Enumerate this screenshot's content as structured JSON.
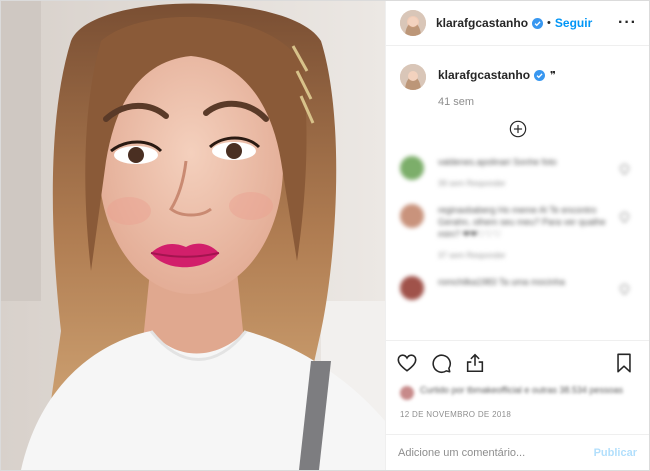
{
  "post": {
    "username": "klarafgcastanho",
    "separator": "•",
    "follow_label": "Seguir",
    "more_label": "···",
    "photo_alt": "selfie",
    "colors": {
      "accent": "#0095f6",
      "publish_disabled": "#b2dffc",
      "muted": "#8e8e8e"
    }
  },
  "caption": {
    "username": "klarafgcastanho",
    "text": "❞",
    "time": "41 sem",
    "load_more_icon": "plus-circle-icon"
  },
  "comments": [
    {
      "user": "valdenes.apolinari",
      "text": "valdenes.apolinari Sonhe foto",
      "meta": "39 sem     Responder"
    },
    {
      "user": "regina.baberg",
      "text": "reginaxbaberg Ho meme Al Te encontro Gerahn, olhem seu meu? Para ver qualhe mim? ❤❤♡♡♡",
      "meta": "37 sem     Responder"
    },
    {
      "user": "romchilka1983",
      "text": "romchilka1983 Ta uma mocinha",
      "meta": ""
    }
  ],
  "actions": {
    "like_icon": "heart-icon",
    "comment_icon": "comment-icon",
    "share_icon": "share-icon",
    "save_icon": "bookmark-icon"
  },
  "likes": {
    "text": "Curtido por tbmakeofficial e outras 38.534 pessoas"
  },
  "date": "12 DE NOVEMBRO DE 2018",
  "add_comment": {
    "placeholder": "Adicione um comentário...",
    "publish_label": "Publicar"
  }
}
